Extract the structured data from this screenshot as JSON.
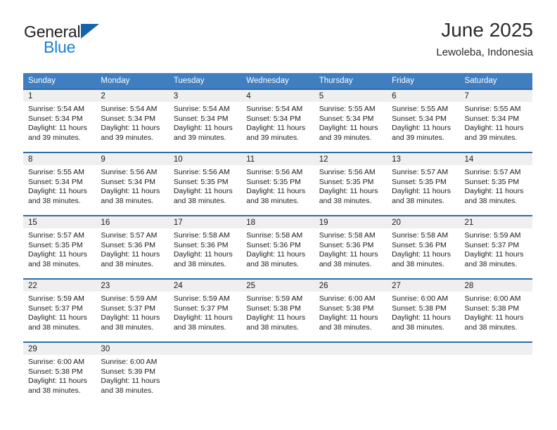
{
  "brand": {
    "name_top": "General",
    "name_bottom": "Blue",
    "triangle_color": "#1464aa",
    "blue_text_color": "#1a7ed6"
  },
  "header": {
    "title": "June 2025",
    "subtitle": "Lewoleba, Indonesia"
  },
  "theme": {
    "header_bg": "#3f7fc1",
    "row_divider": "#2e6da4",
    "daynum_band_bg": "#efefef",
    "text": "#1b1b1b"
  },
  "weekday_headers": [
    "Sunday",
    "Monday",
    "Tuesday",
    "Wednesday",
    "Thursday",
    "Friday",
    "Saturday"
  ],
  "labels": {
    "sunrise_prefix": "Sunrise: ",
    "sunset_prefix": "Sunset: ",
    "daylight_prefix": "Daylight: "
  },
  "weeks": [
    [
      {
        "day": "1",
        "sunrise": "Sunrise: 5:54 AM",
        "sunset": "Sunset: 5:34 PM",
        "daylight": "Daylight: 11 hours and 39 minutes."
      },
      {
        "day": "2",
        "sunrise": "Sunrise: 5:54 AM",
        "sunset": "Sunset: 5:34 PM",
        "daylight": "Daylight: 11 hours and 39 minutes."
      },
      {
        "day": "3",
        "sunrise": "Sunrise: 5:54 AM",
        "sunset": "Sunset: 5:34 PM",
        "daylight": "Daylight: 11 hours and 39 minutes."
      },
      {
        "day": "4",
        "sunrise": "Sunrise: 5:54 AM",
        "sunset": "Sunset: 5:34 PM",
        "daylight": "Daylight: 11 hours and 39 minutes."
      },
      {
        "day": "5",
        "sunrise": "Sunrise: 5:55 AM",
        "sunset": "Sunset: 5:34 PM",
        "daylight": "Daylight: 11 hours and 39 minutes."
      },
      {
        "day": "6",
        "sunrise": "Sunrise: 5:55 AM",
        "sunset": "Sunset: 5:34 PM",
        "daylight": "Daylight: 11 hours and 39 minutes."
      },
      {
        "day": "7",
        "sunrise": "Sunrise: 5:55 AM",
        "sunset": "Sunset: 5:34 PM",
        "daylight": "Daylight: 11 hours and 39 minutes."
      }
    ],
    [
      {
        "day": "8",
        "sunrise": "Sunrise: 5:55 AM",
        "sunset": "Sunset: 5:34 PM",
        "daylight": "Daylight: 11 hours and 38 minutes."
      },
      {
        "day": "9",
        "sunrise": "Sunrise: 5:56 AM",
        "sunset": "Sunset: 5:34 PM",
        "daylight": "Daylight: 11 hours and 38 minutes."
      },
      {
        "day": "10",
        "sunrise": "Sunrise: 5:56 AM",
        "sunset": "Sunset: 5:35 PM",
        "daylight": "Daylight: 11 hours and 38 minutes."
      },
      {
        "day": "11",
        "sunrise": "Sunrise: 5:56 AM",
        "sunset": "Sunset: 5:35 PM",
        "daylight": "Daylight: 11 hours and 38 minutes."
      },
      {
        "day": "12",
        "sunrise": "Sunrise: 5:56 AM",
        "sunset": "Sunset: 5:35 PM",
        "daylight": "Daylight: 11 hours and 38 minutes."
      },
      {
        "day": "13",
        "sunrise": "Sunrise: 5:57 AM",
        "sunset": "Sunset: 5:35 PM",
        "daylight": "Daylight: 11 hours and 38 minutes."
      },
      {
        "day": "14",
        "sunrise": "Sunrise: 5:57 AM",
        "sunset": "Sunset: 5:35 PM",
        "daylight": "Daylight: 11 hours and 38 minutes."
      }
    ],
    [
      {
        "day": "15",
        "sunrise": "Sunrise: 5:57 AM",
        "sunset": "Sunset: 5:35 PM",
        "daylight": "Daylight: 11 hours and 38 minutes."
      },
      {
        "day": "16",
        "sunrise": "Sunrise: 5:57 AM",
        "sunset": "Sunset: 5:36 PM",
        "daylight": "Daylight: 11 hours and 38 minutes."
      },
      {
        "day": "17",
        "sunrise": "Sunrise: 5:58 AM",
        "sunset": "Sunset: 5:36 PM",
        "daylight": "Daylight: 11 hours and 38 minutes."
      },
      {
        "day": "18",
        "sunrise": "Sunrise: 5:58 AM",
        "sunset": "Sunset: 5:36 PM",
        "daylight": "Daylight: 11 hours and 38 minutes."
      },
      {
        "day": "19",
        "sunrise": "Sunrise: 5:58 AM",
        "sunset": "Sunset: 5:36 PM",
        "daylight": "Daylight: 11 hours and 38 minutes."
      },
      {
        "day": "20",
        "sunrise": "Sunrise: 5:58 AM",
        "sunset": "Sunset: 5:36 PM",
        "daylight": "Daylight: 11 hours and 38 minutes."
      },
      {
        "day": "21",
        "sunrise": "Sunrise: 5:59 AM",
        "sunset": "Sunset: 5:37 PM",
        "daylight": "Daylight: 11 hours and 38 minutes."
      }
    ],
    [
      {
        "day": "22",
        "sunrise": "Sunrise: 5:59 AM",
        "sunset": "Sunset: 5:37 PM",
        "daylight": "Daylight: 11 hours and 38 minutes."
      },
      {
        "day": "23",
        "sunrise": "Sunrise: 5:59 AM",
        "sunset": "Sunset: 5:37 PM",
        "daylight": "Daylight: 11 hours and 38 minutes."
      },
      {
        "day": "24",
        "sunrise": "Sunrise: 5:59 AM",
        "sunset": "Sunset: 5:37 PM",
        "daylight": "Daylight: 11 hours and 38 minutes."
      },
      {
        "day": "25",
        "sunrise": "Sunrise: 5:59 AM",
        "sunset": "Sunset: 5:38 PM",
        "daylight": "Daylight: 11 hours and 38 minutes."
      },
      {
        "day": "26",
        "sunrise": "Sunrise: 6:00 AM",
        "sunset": "Sunset: 5:38 PM",
        "daylight": "Daylight: 11 hours and 38 minutes."
      },
      {
        "day": "27",
        "sunrise": "Sunrise: 6:00 AM",
        "sunset": "Sunset: 5:38 PM",
        "daylight": "Daylight: 11 hours and 38 minutes."
      },
      {
        "day": "28",
        "sunrise": "Sunrise: 6:00 AM",
        "sunset": "Sunset: 5:38 PM",
        "daylight": "Daylight: 11 hours and 38 minutes."
      }
    ],
    [
      {
        "day": "29",
        "sunrise": "Sunrise: 6:00 AM",
        "sunset": "Sunset: 5:38 PM",
        "daylight": "Daylight: 11 hours and 38 minutes."
      },
      {
        "day": "30",
        "sunrise": "Sunrise: 6:00 AM",
        "sunset": "Sunset: 5:39 PM",
        "daylight": "Daylight: 11 hours and 38 minutes."
      },
      {
        "day": "",
        "sunrise": "",
        "sunset": "",
        "daylight": ""
      },
      {
        "day": "",
        "sunrise": "",
        "sunset": "",
        "daylight": ""
      },
      {
        "day": "",
        "sunrise": "",
        "sunset": "",
        "daylight": ""
      },
      {
        "day": "",
        "sunrise": "",
        "sunset": "",
        "daylight": ""
      },
      {
        "day": "",
        "sunrise": "",
        "sunset": "",
        "daylight": ""
      }
    ]
  ]
}
